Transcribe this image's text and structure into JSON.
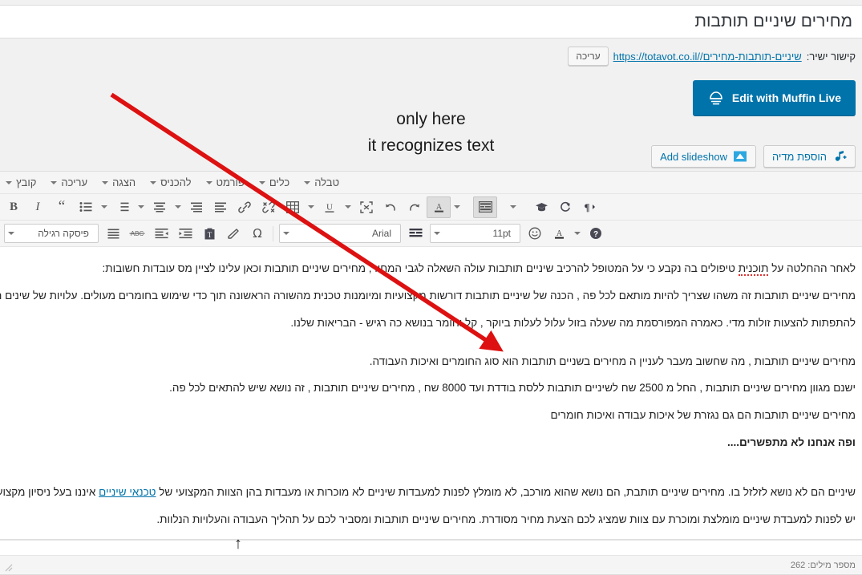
{
  "title": {
    "value": "מחירים שיניים תותבות"
  },
  "permalink": {
    "label": "קישור ישיר:",
    "url_domain": "https://totavot.co.il/",
    "url_slug": "שיניים-תותבות-מחירים/",
    "edit_button": "עריכה"
  },
  "muffin": {
    "label": "Edit with Muffin Live",
    "icon": "muffin-icon",
    "color": "#0073aa"
  },
  "media": {
    "add_media": "הוספת מדיה",
    "add_media_icon": "add-media-icon",
    "add_slideshow": "Add slideshow",
    "add_slideshow_icon": "slideshow-icon"
  },
  "editor": {
    "menubar": [
      {
        "label": "קובץ",
        "name": "menu-file"
      },
      {
        "label": "עריכה",
        "name": "menu-edit"
      },
      {
        "label": "הצגה",
        "name": "menu-view"
      },
      {
        "label": "להכניס",
        "name": "menu-insert"
      },
      {
        "label": "פורמט",
        "name": "menu-format"
      },
      {
        "label": "כלים",
        "name": "menu-tools"
      },
      {
        "label": "טבלה",
        "name": "menu-table"
      }
    ],
    "toolbar_row1": [
      {
        "name": "bold-button",
        "icon": "bold-icon",
        "label": "B"
      },
      {
        "name": "italic-button",
        "icon": "italic-icon",
        "label": "I"
      },
      {
        "name": "blockquote-button",
        "icon": "quote-icon",
        "label": "“"
      },
      {
        "name": "bullet-list-button",
        "icon": "unordered-list-icon"
      },
      {
        "name": "bullet-list-caret",
        "icon": "chevron-down-icon"
      },
      {
        "name": "numbered-list-button",
        "icon": "ordered-list-icon"
      },
      {
        "name": "numbered-list-caret",
        "icon": "chevron-down-icon"
      },
      {
        "name": "align-center-button",
        "icon": "align-center-icon"
      },
      {
        "name": "align-justify-caret",
        "icon": "chevron-down-icon"
      },
      {
        "name": "align-right-button",
        "icon": "align-right-icon"
      },
      {
        "name": "align-left-button",
        "icon": "align-left-icon"
      },
      {
        "name": "insert-link-button",
        "icon": "link-icon"
      },
      {
        "name": "remove-link-button",
        "icon": "unlink-icon"
      },
      {
        "name": "insert-table-button",
        "icon": "table-icon"
      },
      {
        "name": "table-caret",
        "icon": "chevron-down-icon"
      },
      {
        "name": "underline-button",
        "icon": "underline-icon"
      },
      {
        "name": "underline-caret",
        "icon": "chevron-down-icon"
      },
      {
        "name": "fullscreen-button",
        "icon": "fullscreen-icon"
      },
      {
        "name": "undo-button",
        "icon": "undo-icon"
      },
      {
        "name": "redo-button",
        "icon": "redo-icon"
      },
      {
        "name": "text-color-button",
        "icon": "text-color-icon"
      },
      {
        "name": "text-color-caret",
        "icon": "chevron-down-icon"
      },
      {
        "name": "toggle-toolbar-button",
        "icon": "kitchen-sink-icon"
      },
      {
        "name": "templates-caret",
        "icon": "chevron-down-icon"
      },
      {
        "name": "education-button",
        "icon": "graduation-cap-icon"
      },
      {
        "name": "reload-button",
        "icon": "refresh-icon"
      },
      {
        "name": "rtl-button",
        "icon": "pilcrow-rtl-icon"
      }
    ],
    "style_select": {
      "value": "פיסקה רגילה",
      "name": "paragraph-style-select"
    },
    "font_select": {
      "value": "Arial",
      "name": "font-family-select"
    },
    "size_select": {
      "value": "11pt",
      "name": "font-size-select"
    },
    "toolbar_row2": [
      {
        "name": "align-list-button",
        "icon": "align-lines-icon"
      },
      {
        "name": "strikethrough-button",
        "icon": "strikethrough-icon",
        "label": "ABC"
      },
      {
        "name": "outdent-button",
        "icon": "outdent-icon"
      },
      {
        "name": "indent-button",
        "icon": "indent-icon"
      },
      {
        "name": "paste-text-button",
        "icon": "paste-as-text-icon"
      },
      {
        "name": "clear-formatting-button",
        "icon": "eraser-icon"
      },
      {
        "name": "special-character-button",
        "icon": "omega-icon",
        "label": "Ω"
      },
      {
        "name": "line-height-button",
        "icon": "line-height-icon"
      },
      {
        "name": "emoji-button",
        "icon": "smiley-icon"
      },
      {
        "name": "highlight-color-button",
        "icon": "background-color-icon"
      },
      {
        "name": "highlight-caret",
        "icon": "chevron-down-icon"
      },
      {
        "name": "help-button",
        "icon": "help-icon"
      }
    ],
    "status": {
      "word_count": "מספר מילים: 262"
    }
  },
  "content": {
    "paragraphs": [
      {
        "id": "p1",
        "pre": "לאחר ההחלטה על ",
        "spell": "תוכנית",
        "post": " טיפולים בה נקבע כי על המטופל להרכיב שיניים תותבות עולה השאלה לגבי המחיר, מחירים שיניים תותבות  וכאן עלינו לציין מס עובדות חשובות:"
      },
      {
        "id": "p2",
        "text": "מחירים שיניים תותבות זה משהו שצריך להיות מותאם לכל פה , הכנה של שיניים תותבות דורשות מקצועיות ומיומנות טכנית מהשורה הראשונה תוך כדי שימוש בחומרים מעולים. עלויות של שינים תותב"
      },
      {
        "id": "p3",
        "text": "להתפתות להצעות זולות מדי.  כאמרה המפורסמת מה שעלה בזול עלול לעלות ביוקר , קל וחומר בנושא כה רגיש  -  הבריאות שלנו."
      },
      {
        "id": "p4",
        "text": "מחירים שיניים תותבות , מה שחשוב מעבר לעניין ה מחירים בשניים תותבות הוא סוג החומרים ואיכות העבודה."
      },
      {
        "id": "p5",
        "text": "ישנם מגוון מחירים שיניים תותבות , החל מ 2500 שח לשיניים תותבות ללסת בודדת  ועד 8000 שח , מחירים שיניים תותבות , זה נושא שיש להתאים לכל פה."
      },
      {
        "id": "p6",
        "text": "מחירים שיניים תותבות הם גם נגזרת של איכות עבודה ואיכות חומרים"
      },
      {
        "id": "p7",
        "bold": true,
        "text": "ופה אנחנו לא מתפשרים...."
      },
      {
        "id": "p8",
        "pre": "שיניים הם לא נושא לזלזל בו. מחירים שיניים תותבת, הם נושא שהוא מורכב,  לא מומלץ לפנות למעבדות שיניים לא מוכרות או מעבדות בהן הצוות המקצועי של ",
        "link": "טכנאי שיניים",
        "post": " איננו בעל ניסיון מקצועי , ה"
      },
      {
        "id": "p9",
        "text": "יש לפנות למעבדת שיניים מומלצת ומוכרת עם צוות שמציג לכם הצעת מחיר מסודרת. מחירים שיניים תותבות ומסביר לכם על תהליך העבודה והעלויות הנלוות."
      }
    ]
  },
  "annotation": {
    "line1": "only here",
    "line2": "it recognizes text",
    "arrow_color": "#dd1111"
  }
}
